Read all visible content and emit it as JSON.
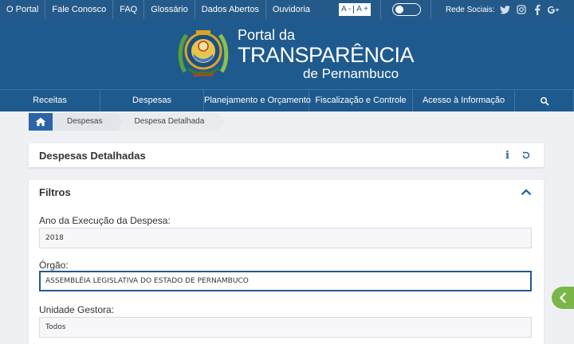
{
  "topbar": {
    "links": [
      "O Portal",
      "Fale Conosco",
      "FAQ",
      "Glossário",
      "Dados Abertos",
      "Ouvidoria"
    ],
    "font_decrease": "A -",
    "font_increase": "A +",
    "social_label": "Rede Sociais:",
    "social_icons": [
      "twitter-icon",
      "instagram-icon",
      "facebook-icon",
      "google-plus-icon"
    ]
  },
  "brand": {
    "line1": "Portal da",
    "line2": "TRANSPARÊNCIA",
    "line3": "de Pernambuco"
  },
  "nav": {
    "items": [
      "Receitas",
      "Despesas",
      "Planejamento e Orçamento",
      "Fiscalização e Controle",
      "Acesso à Informação"
    ]
  },
  "breadcrumb": {
    "items": [
      "Despesas",
      "Despesa Detalhada"
    ]
  },
  "panel": {
    "title": "Despesas Detalhadas",
    "info_glyph": "i"
  },
  "filters": {
    "title": "Filtros",
    "ano_label": "Ano da Execução da Despesa:",
    "ano_value": "2018",
    "orgao_label": "Órgão:",
    "orgao_value": "ASSEMBLÉIA LEGISLATIVA DO ESTADO DE PERNAMBUCO",
    "unidade_label": "Unidade Gestora:",
    "unidade_value": "Todos"
  },
  "colors": {
    "primary": "#1f5a8e",
    "accent": "#2b64a8",
    "side_tab": "#7ab648"
  }
}
